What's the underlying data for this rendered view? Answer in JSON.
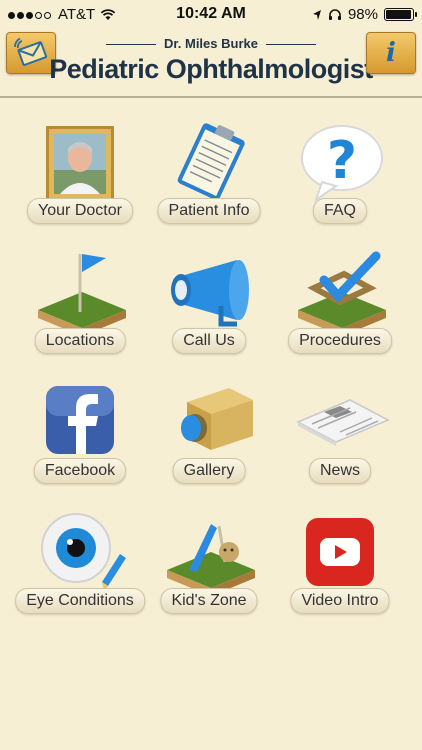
{
  "status_bar": {
    "carrier": "AT&T",
    "time": "10:42 AM",
    "battery": "98%",
    "battery_level": 0.98,
    "signal_bars_filled": 3,
    "signal_bars_total": 5
  },
  "header": {
    "subtitle": "Dr. Miles Burke",
    "title": "Pediatric Ophthalmologist",
    "left_button_icon": "envelope-icon",
    "right_button_icon": "info-icon",
    "right_button_text": "i",
    "accent_color": "#e4ac44"
  },
  "menu": [
    {
      "label": "Your Doctor",
      "icon": "doctor-photo-icon"
    },
    {
      "label": "Patient Info",
      "icon": "clipboard-icon"
    },
    {
      "label": "FAQ",
      "icon": "question-bubble-icon"
    },
    {
      "label": "Locations",
      "icon": "flag-icon"
    },
    {
      "label": "Call Us",
      "icon": "megaphone-icon"
    },
    {
      "label": "Procedures",
      "icon": "checkmark-icon"
    },
    {
      "label": "Facebook",
      "icon": "facebook-icon"
    },
    {
      "label": "Gallery",
      "icon": "camera-icon"
    },
    {
      "label": "News",
      "icon": "newspaper-icon"
    },
    {
      "label": "Eye Conditions",
      "icon": "eye-icon"
    },
    {
      "label": "Kid's Zone",
      "icon": "playground-icon"
    },
    {
      "label": "Video Intro",
      "icon": "youtube-play-icon"
    }
  ]
}
